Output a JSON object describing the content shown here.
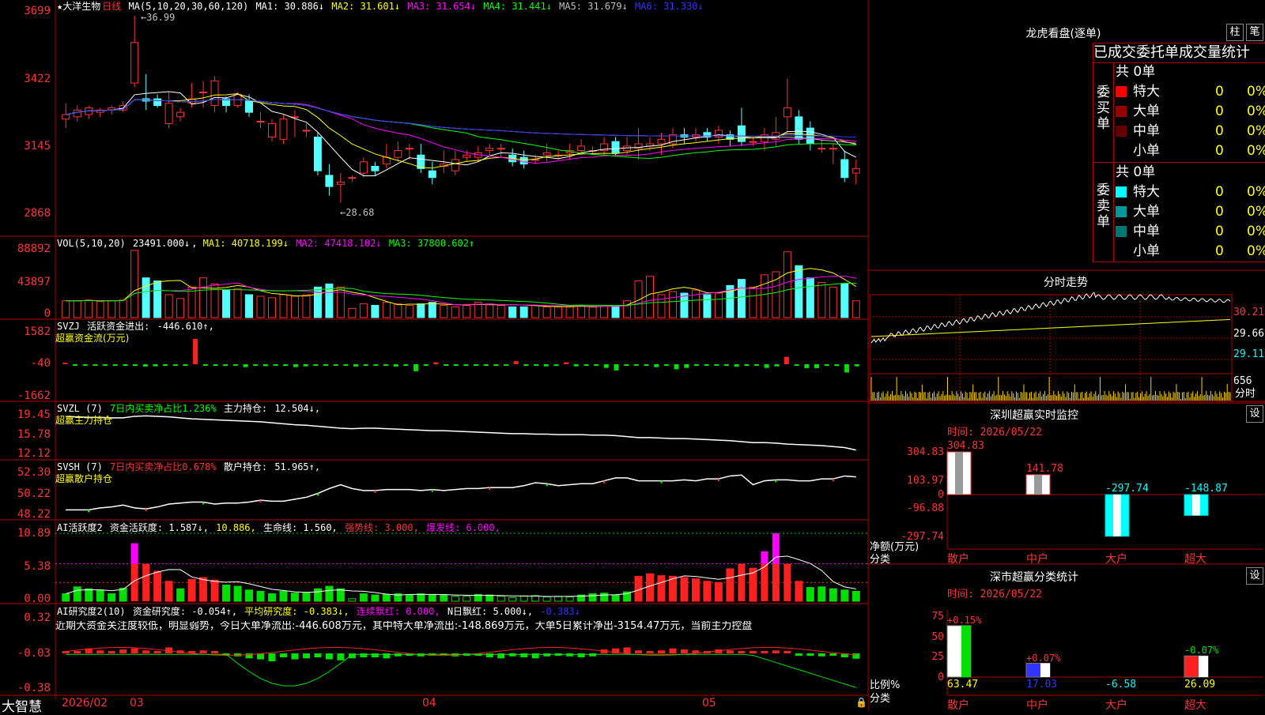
{
  "stock": {
    "name": "★大洋生物",
    "period": "日线",
    "ma_header": "MA(5,10,20,30,60,120)",
    "ma": [
      {
        "label": "MA1:",
        "value": "30.886↓",
        "color": "#ffffff"
      },
      {
        "label": "MA2:",
        "value": "31.601↓",
        "color": "#ffff00"
      },
      {
        "label": "MA3:",
        "value": "31.654↓",
        "color": "#ff00ff"
      },
      {
        "label": "MA4:",
        "value": "31.441↓",
        "color": "#00ff00"
      },
      {
        "label": "MA5:",
        "value": "31.679↓",
        "color": "#c0c0c0"
      },
      {
        "label": "MA6:",
        "value": "31.330↓",
        "color": "#3333ff"
      }
    ],
    "high_note": "36.99",
    "low_note": "28.68",
    "price_ticks": [
      "3699",
      "3422",
      "3145",
      "2868"
    ]
  },
  "vol": {
    "header": "VOL(5,10,20)",
    "value": "23491.000↓",
    "ma": [
      {
        "label": "MA1:",
        "value": "40718.199↓",
        "color": "#ffff00"
      },
      {
        "label": "MA2:",
        "value": "47418.102↓",
        "color": "#ff00ff"
      },
      {
        "label": "MA3:",
        "value": "37800.602↑",
        "color": "#00ff00"
      }
    ],
    "ticks": [
      "88892",
      "43897",
      "0"
    ]
  },
  "svzj": {
    "header": "SVZJ",
    "label": "活跃资金进出:",
    "value": "-446.610↑,",
    "sub": "超赢资金流(万元)",
    "ticks": [
      "1582",
      "-40",
      "-1662"
    ]
  },
  "svzl": {
    "header": "SVZL (7)",
    "ratio": "7日内买卖净占比1.236%",
    "label": "主力持仓:",
    "value": "12.504↓,",
    "sub": "超赢主力持仓",
    "ticks": [
      "19.45",
      "15.78",
      "12.12"
    ]
  },
  "svsh": {
    "header": "SVSH (7)",
    "ratio": "7日内买卖净占比0.678%",
    "label": "散户持仓:",
    "value": "51.965↑,",
    "sub": "超赢散户持仓",
    "ticks": [
      "52.30",
      "50.22",
      "48.22"
    ]
  },
  "ai1": {
    "header": "AI活跃度2",
    "items": [
      {
        "text": "资金活跃度: 1.587↓,",
        "color": "#ffffff"
      },
      {
        "text": "10.886,",
        "color": "#ffff00"
      },
      {
        "text": "生命线: 1.560,",
        "color": "#ffffff"
      },
      {
        "text": "强势线: 3.000,",
        "color": "#ff3333"
      },
      {
        "text": "爆发线: 6.000,",
        "color": "#ff00ff"
      }
    ],
    "ticks": [
      "10.89",
      "5.38",
      "0.00"
    ]
  },
  "ai2": {
    "header": "AI研究度2(10)",
    "items": [
      {
        "text": "资金研究度: -0.054↑,",
        "color": "#ffffff"
      },
      {
        "text": "平均研究度: -0.383↓,",
        "color": "#ffff00"
      },
      {
        "text": "连续飘红: 0.000,",
        "color": "#ff00ff"
      },
      {
        "text": "N日飘红: 5.000↓,",
        "color": "#ffffff"
      },
      {
        "text": "-0.383↓",
        "color": "#3333ff"
      }
    ],
    "comment": "近期大资金关注度较低，明显弱势，今日大单净流出:-446.608万元，其中特大单净流出:-148.869万元，大单5日累计净出-3154.47万元，当前主力控盘",
    "ticks": [
      "0.32",
      "-0.03",
      "-0.38"
    ]
  },
  "footer": {
    "brand": "大智慧",
    "dates": [
      "2026/02",
      "03",
      "04",
      "05"
    ]
  },
  "dragon": {
    "title": "龙虎看盘(逐单)",
    "btn_bar": "柱",
    "btn_pen": "笔",
    "subtitle": "已成交委托单成交量统计",
    "buy_label": "委买单",
    "sell_label": "委卖单",
    "buy_total": "共 0单",
    "sell_total": "共 0单",
    "buy_rows": [
      {
        "name": "特大",
        "count": "0",
        "pct": "0%",
        "color": "#ff0000"
      },
      {
        "name": "大单",
        "count": "0",
        "pct": "0%",
        "color": "#990000"
      },
      {
        "name": "中单",
        "count": "0",
        "pct": "0%",
        "color": "#660000"
      },
      {
        "name": "小单",
        "count": "0",
        "pct": "0%",
        "color": "#000000"
      }
    ],
    "sell_rows": [
      {
        "name": "特大",
        "count": "0",
        "pct": "0%",
        "color": "#00ffff"
      },
      {
        "name": "大单",
        "count": "0",
        "pct": "0%",
        "color": "#009999"
      },
      {
        "name": "中单",
        "count": "0",
        "pct": "0%",
        "color": "#007777"
      },
      {
        "name": "小单",
        "count": "0",
        "pct": "0%",
        "color": "#000000"
      }
    ]
  },
  "intraday": {
    "title": "分时走势",
    "ticks": [
      "30.21",
      "29.66",
      "29.11"
    ],
    "vol_tick": "656",
    "vol_label": "分时"
  },
  "sz_monitor": {
    "title": "深圳超赢实时监控",
    "btn": "设",
    "time": "时间: 2026/05/22",
    "ticks": [
      "304.83",
      "103.97",
      "0",
      "-96.88",
      "-297.74"
    ],
    "yname": "净额(万元)",
    "xname": "分类",
    "categories": [
      "散户",
      "中户",
      "大户",
      "超大"
    ],
    "values": [
      304.83,
      141.78,
      -297.74,
      -148.87
    ],
    "labels": [
      "304.83",
      "141.78",
      "-297.74",
      "-148.87"
    ]
  },
  "sz_class": {
    "title": "深市超赢分类统计",
    "btn": "设",
    "time": "时间: 2026/05/22",
    "ticks": [
      "75",
      "50",
      "25",
      "0"
    ],
    "yname": "比例%",
    "xname": "分类",
    "categories": [
      "散户",
      "中户",
      "大户",
      "超大"
    ],
    "values": [
      63.47,
      17.03,
      -6.58,
      26.09
    ],
    "top_labels": [
      "+0.15%",
      "+0.07%",
      "",
      "-0.07%"
    ],
    "bottom_labels": [
      "63.47",
      "17.03",
      "-6.58",
      "26.09"
    ]
  },
  "chart_data": {
    "type": "candlestick",
    "title": "大洋生物 日线",
    "ylim": [
      28.0,
      37.2
    ],
    "candles": [
      [
        32.4,
        32.6,
        32.0,
        33.1
      ],
      [
        32.5,
        32.8,
        32.3,
        33.0
      ],
      [
        32.6,
        32.9,
        32.4,
        33.0
      ],
      [
        32.7,
        32.8,
        32.5,
        32.9
      ],
      [
        32.8,
        32.9,
        32.6,
        33.0
      ],
      [
        32.8,
        33.0,
        32.7,
        33.2
      ],
      [
        34.0,
        35.8,
        33.8,
        36.99
      ],
      [
        33.3,
        33.2,
        32.8,
        34.4
      ],
      [
        33.3,
        33.0,
        32.9,
        33.5
      ],
      [
        32.2,
        33.1,
        32.0,
        33.6
      ],
      [
        32.5,
        32.7,
        32.3,
        32.9
      ],
      [
        33.1,
        33.3,
        32.9,
        34.0
      ],
      [
        33.6,
        33.6,
        32.9,
        34.1
      ],
      [
        33.0,
        34.1,
        32.7,
        34.3
      ],
      [
        33.3,
        33.0,
        32.7,
        33.4
      ],
      [
        33.0,
        33.5,
        32.9,
        33.6
      ],
      [
        33.2,
        32.7,
        32.5,
        33.5
      ],
      [
        32.3,
        32.3,
        32.0,
        32.7
      ],
      [
        31.6,
        32.2,
        31.4,
        32.4
      ],
      [
        31.5,
        32.4,
        31.3,
        32.6
      ],
      [
        32.5,
        32.5,
        31.6,
        32.8
      ],
      [
        31.9,
        31.9,
        31.6,
        32.2
      ],
      [
        31.6,
        30.1,
        29.9,
        31.8
      ],
      [
        29.9,
        29.4,
        29.0,
        30.4
      ],
      [
        29.5,
        29.6,
        28.68,
        30.0
      ],
      [
        29.8,
        29.8,
        29.6,
        29.9
      ],
      [
        30.0,
        30.5,
        29.8,
        30.7
      ],
      [
        30.3,
        30.1,
        29.9,
        30.5
      ],
      [
        30.4,
        30.7,
        30.2,
        31.3
      ],
      [
        30.7,
        31.0,
        30.5,
        31.4
      ],
      [
        31.1,
        31.1,
        30.6,
        31.3
      ],
      [
        30.8,
        30.2,
        30.0,
        31.3
      ],
      [
        30.1,
        29.8,
        29.5,
        30.5
      ],
      [
        30.3,
        30.4,
        30.0,
        31.0
      ],
      [
        30.1,
        30.6,
        29.9,
        31.0
      ],
      [
        30.7,
        30.8,
        30.5,
        31.0
      ],
      [
        30.7,
        30.9,
        30.5,
        31.2
      ],
      [
        31.0,
        31.1,
        30.7,
        31.3
      ],
      [
        31.1,
        31.1,
        30.7,
        31.3
      ],
      [
        30.8,
        30.5,
        30.3,
        31.1
      ],
      [
        30.7,
        30.4,
        30.2,
        31.0
      ],
      [
        30.6,
        30.6,
        30.4,
        30.8
      ],
      [
        30.8,
        30.9,
        30.5,
        31.3
      ],
      [
        30.8,
        30.8,
        30.6,
        31.0
      ],
      [
        30.9,
        31.0,
        30.6,
        31.3
      ],
      [
        31.0,
        31.2,
        30.8,
        31.5
      ],
      [
        31.0,
        31.0,
        30.8,
        31.2
      ],
      [
        31.0,
        31.3,
        30.8,
        31.6
      ],
      [
        31.4,
        30.9,
        30.8,
        31.6
      ],
      [
        31.0,
        31.2,
        30.8,
        31.6
      ],
      [
        31.1,
        31.3,
        30.6,
        32.0
      ],
      [
        31.2,
        31.3,
        31.0,
        31.6
      ],
      [
        31.3,
        31.5,
        30.8,
        31.8
      ],
      [
        31.3,
        31.7,
        31.1,
        32.0
      ],
      [
        31.7,
        31.6,
        31.3,
        32.0
      ],
      [
        31.6,
        31.7,
        31.4,
        32.0
      ],
      [
        31.8,
        31.6,
        31.4,
        32.0
      ],
      [
        31.6,
        31.9,
        31.3,
        32.1
      ],
      [
        31.7,
        31.5,
        31.2,
        31.9
      ],
      [
        32.1,
        31.4,
        31.2,
        32.9
      ],
      [
        31.4,
        31.4,
        31.2,
        31.6
      ],
      [
        31.4,
        31.7,
        31.0,
        32.0
      ],
      [
        31.5,
        31.8,
        31.2,
        32.5
      ],
      [
        32.5,
        32.9,
        31.8,
        34.2
      ],
      [
        32.5,
        31.5,
        31.3,
        32.8
      ],
      [
        32.0,
        31.3,
        31.0,
        32.3
      ],
      [
        31.1,
        31.1,
        30.9,
        31.5
      ],
      [
        31.1,
        31.1,
        30.4,
        31.3
      ],
      [
        30.6,
        29.8,
        29.6,
        31.0
      ],
      [
        30.0,
        30.2,
        29.5,
        30.6
      ]
    ],
    "volume": [
      22,
      22,
      23,
      21,
      22,
      23,
      88,
      52,
      48,
      30,
      25,
      40,
      52,
      44,
      36,
      38,
      30,
      28,
      26,
      30,
      28,
      30,
      40,
      44,
      40,
      12,
      18,
      16,
      20,
      18,
      16,
      18,
      20,
      16,
      14,
      16,
      20,
      18,
      16,
      14,
      14,
      16,
      14,
      14,
      14,
      16,
      14,
      16,
      14,
      22,
      48,
      54,
      30,
      34,
      32,
      36,
      30,
      32,
      42,
      50,
      40,
      56,
      60,
      86,
      68,
      52,
      46,
      40,
      44,
      22
    ],
    "svzj": [
      40,
      -20,
      -10,
      -80,
      -60,
      -20,
      -60,
      -90,
      -120,
      -110,
      -40,
      -40,
      -60,
      1300,
      -40,
      -70,
      -90,
      -20,
      -150,
      -70,
      -100,
      -60,
      -90,
      -150,
      -110,
      -60,
      -20,
      -10,
      -30,
      -120,
      -60,
      -20,
      -40,
      -120,
      -30,
      -360,
      -60,
      100,
      -40,
      -20,
      -30,
      -50,
      -40,
      -90,
      -30,
      160,
      -40,
      -60,
      -110,
      -90,
      100,
      -110,
      -20,
      -30,
      -190,
      -320,
      -40,
      -30,
      -60,
      -150,
      -80,
      -260,
      -190,
      -60,
      -30,
      -20,
      -40,
      -130,
      -60,
      -40,
      -190,
      -110,
      380,
      -70,
      -200,
      -200,
      -40,
      -90,
      -420,
      -110
    ],
    "svzl": [
      19.2,
      19.2,
      19.1,
      19.1,
      19.0,
      19.0,
      19.3,
      19.4,
      19.3,
      19.2,
      19.0,
      18.8,
      18.7,
      18.6,
      18.5,
      18.4,
      18.3,
      18.2,
      18.0,
      17.8,
      17.6,
      17.5,
      17.3,
      17.1,
      16.9,
      16.8,
      16.9,
      16.9,
      16.8,
      16.7,
      16.6,
      16.5,
      16.4,
      16.4,
      16.3,
      16.2,
      16.1,
      16.0,
      15.9,
      15.8,
      15.8,
      15.7,
      15.7,
      15.6,
      15.6,
      15.6,
      15.5,
      15.5,
      15.4,
      15.2,
      15.0,
      15.0,
      14.9,
      14.8,
      14.8,
      14.7,
      14.6,
      14.5,
      14.4,
      14.2,
      14.0,
      14.0,
      13.9,
      13.7,
      13.6,
      13.5,
      13.4,
      13.2,
      13.0,
      12.5
    ],
    "svsh": [
      48.6,
      48.6,
      48.6,
      48.8,
      48.9,
      49.1,
      48.8,
      48.7,
      48.9,
      49.2,
      49.3,
      49.4,
      49.4,
      49.2,
      49.3,
      49.3,
      49.4,
      49.6,
      49.5,
      49.5,
      49.7,
      49.9,
      50.3,
      50.8,
      51.2,
      50.8,
      50.6,
      50.6,
      50.7,
      50.7,
      50.7,
      50.6,
      50.7,
      50.6,
      50.7,
      50.8,
      50.8,
      50.9,
      50.9,
      50.9,
      51.1,
      51.4,
      51.3,
      51.1,
      51.2,
      51.3,
      51.3,
      51.6,
      51.9,
      51.9,
      51.6,
      51.6,
      51.6,
      51.6,
      51.7,
      51.6,
      51.8,
      51.8,
      52.1,
      52.2,
      51.2,
      51.6,
      51.7,
      51.7,
      51.6,
      51.6,
      51.8,
      51.8,
      52.1,
      52.0
    ],
    "ai_activity": [
      1.2,
      2.3,
      2.0,
      1.8,
      1.2,
      2.1,
      9.3,
      6.0,
      4.8,
      3.2,
      2.0,
      3.5,
      3.8,
      3.4,
      2.6,
      2.4,
      1.8,
      1.6,
      1.2,
      1.6,
      1.3,
      1.4,
      2.0,
      2.4,
      2.0,
      0.4,
      1.2,
      1.0,
      1.1,
      1.2,
      1.0,
      1.2,
      1.0,
      1.0,
      0.8,
      0.8,
      1.1,
      1.0,
      0.8,
      0.6,
      0.8,
      0.9,
      0.7,
      0.8,
      0.7,
      1.0,
      1.2,
      1.3,
      1.0,
      1.5,
      4.0,
      4.4,
      4.1,
      4.0,
      3.8,
      3.6,
      3.2,
      3.0,
      5.2,
      6.0,
      5.3,
      8.0,
      10.89,
      6.0,
      3.2,
      2.2,
      2.3,
      2.0,
      1.8,
      1.587
    ],
    "ai_research": [
      0.0,
      0.0,
      0.05,
      0.03,
      0.0,
      0.04,
      0.05,
      0.03,
      0.0,
      0.06,
      0.03,
      0.0,
      0.03,
      0.0,
      -0.02,
      -0.03,
      -0.05,
      -0.06,
      -0.08,
      -0.04,
      -0.06,
      -0.05,
      -0.04,
      -0.06,
      -0.07,
      -0.05,
      -0.04,
      -0.04,
      -0.05,
      -0.03,
      -0.02,
      -0.03,
      -0.02,
      -0.01,
      -0.03,
      -0.02,
      -0.02,
      -0.04,
      -0.05,
      -0.03,
      -0.04,
      -0.05,
      -0.03,
      -0.02,
      -0.03,
      -0.04,
      -0.03,
      0.04,
      0.05,
      0.06,
      0.03,
      0.02,
      0.03,
      0.05,
      0.04,
      0.03,
      0.02,
      0.04,
      0.03,
      0.02,
      0.01,
      0.02,
      0.03,
      0.02,
      -0.02,
      -0.02,
      -0.03,
      -0.02,
      -0.04,
      -0.054
    ]
  }
}
